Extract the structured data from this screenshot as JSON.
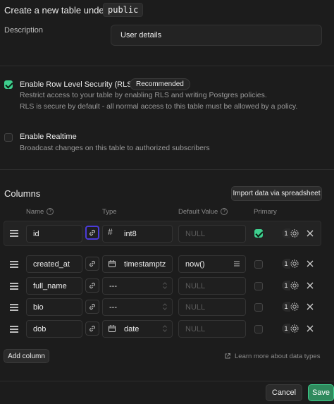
{
  "header": {
    "title": "Create a new table under",
    "schema": "public"
  },
  "description": {
    "label": "Description",
    "value": "User details"
  },
  "rls": {
    "label": "Enable Row Level Security (RLS)",
    "badge": "Recommended",
    "checked": true,
    "desc_line1": "Restrict access to your table by enabling RLS and writing Postgres policies.",
    "desc_line2": "RLS is secure by default - all normal access to this table must be allowed by a policy."
  },
  "realtime": {
    "label": "Enable Realtime",
    "checked": false,
    "desc": "Broadcast changes on this table to authorized subscribers"
  },
  "columns": {
    "title": "Columns",
    "import_label": "Import data via spreadsheet",
    "headers": {
      "name": "Name",
      "type": "Type",
      "default": "Default Value",
      "primary": "Primary"
    },
    "rows": [
      {
        "name": "id",
        "type": "int8",
        "type_icon": "hash-icon",
        "default": "NULL",
        "primary": true,
        "count": "1"
      },
      {
        "name": "created_at",
        "type": "timestamptz",
        "type_icon": "calendar-icon",
        "default": "now()",
        "primary": false,
        "count": "1"
      },
      {
        "name": "full_name",
        "type": "---",
        "type_icon": "",
        "default": "NULL",
        "primary": false,
        "count": "1"
      },
      {
        "name": "bio",
        "type": "---",
        "type_icon": "",
        "default": "NULL",
        "primary": false,
        "count": "1"
      },
      {
        "name": "dob",
        "type": "date",
        "type_icon": "calendar-icon",
        "default": "NULL",
        "primary": false,
        "count": "1"
      }
    ],
    "add_label": "Add column",
    "learn_more": "Learn more about data types"
  },
  "footer": {
    "cancel": "Cancel",
    "save": "Save"
  },
  "colors": {
    "accent": "#3ecf8e",
    "background": "#1c1c1c",
    "focus": "#4b3bd9"
  }
}
